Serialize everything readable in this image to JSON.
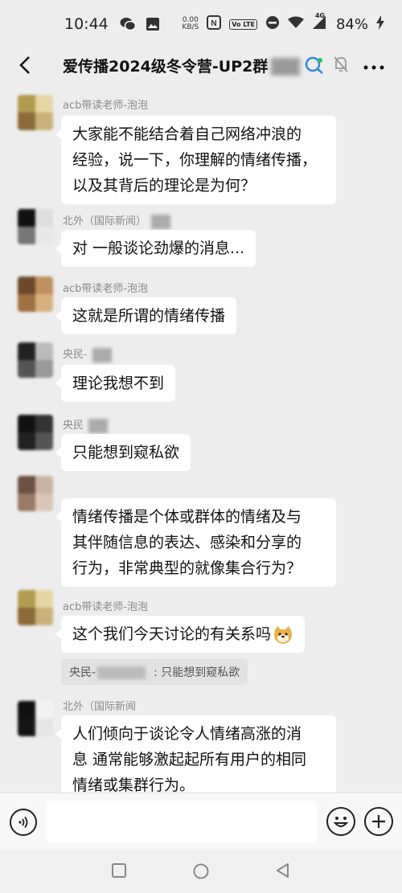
{
  "status_bar": {
    "time": "10:44",
    "net_speed_value": "0.00",
    "net_speed_unit": "KB/S",
    "volte_label": "Vo LTE",
    "signal_type": "4G",
    "battery": "84%",
    "icons": [
      "wechat-icon",
      "gallery-icon",
      "nfc-icon",
      "volte-icon",
      "dnd-icon",
      "wifi-icon",
      "signal-icon",
      "battery-icon",
      "charging-icon"
    ]
  },
  "header": {
    "title": "爱传播2024级冬令营-UP2群",
    "icons": [
      "back-icon",
      "search-icon",
      "mute-icon",
      "more-icon"
    ]
  },
  "messages": [
    {
      "sender": "acb带读老师-泡泡",
      "lines": [
        "大家能不能结合着自己网络冲浪的",
        "经验，说一下，你理解的情绪传播，",
        "以及其背后的理论是为何？"
      ]
    },
    {
      "sender": "北外（国际新闻）",
      "lines": [
        "对 一般谈论劲爆的消息..."
      ]
    },
    {
      "sender": "acb带读老师-泡泡",
      "lines": [
        "这就是所谓的情绪传播"
      ]
    },
    {
      "sender": "央民-",
      "lines": [
        "理论我想不到"
      ]
    },
    {
      "sender": "央民",
      "lines": [
        "只能想到窥私欲"
      ]
    },
    {
      "sender": "",
      "lines": [
        "情绪传播是个体或群体的情绪及与",
        "其伴随信息的表达、感染和分享的",
        "行为，非常典型的就像集合行为？"
      ]
    },
    {
      "sender": "acb带读老师-泡泡",
      "lines": [
        "这个我们今天讨论的有关系吗"
      ],
      "emoji": "doge-emoji-icon",
      "quote": {
        "prefix": "央民-",
        "text": "只能想到窥私欲"
      }
    },
    {
      "sender": "北外（国际新闻",
      "lines": [
        "人们倾向于谈论令人情绪高涨的消",
        "息 通常能够激起起所有用户的相同",
        "情绪或集群行为。"
      ]
    }
  ],
  "input": {
    "value": "",
    "placeholder": "",
    "icons": [
      "voice-icon",
      "emoji-icon",
      "plus-icon"
    ]
  },
  "nav": {
    "icons": [
      "recent-apps-icon",
      "home-icon",
      "back-nav-icon"
    ]
  },
  "colors": {
    "background": "#ededed",
    "bubble": "#ffffff",
    "sender_text": "#8a8a8a",
    "quote_bg": "#e2e2e2"
  }
}
